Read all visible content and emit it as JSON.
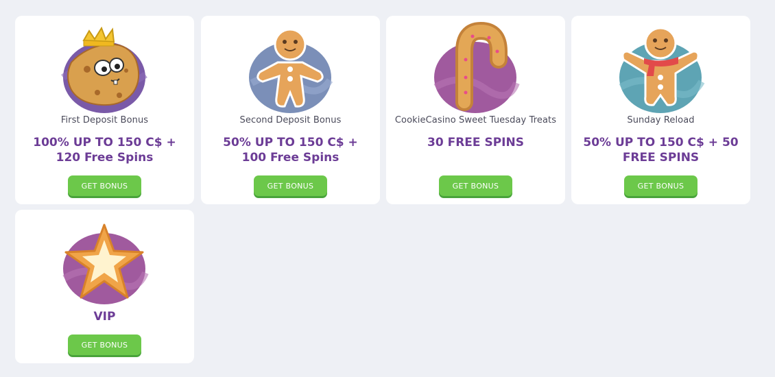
{
  "colors": {
    "page_bg": "#eef0f5",
    "card_bg": "#ffffff",
    "headline": "#6c3c96",
    "button": "#6cc84a",
    "button_shadow": "#48a33a",
    "subtitle": "#4a4a5a"
  },
  "cards": [
    {
      "icon": "crowned-cookie-icon",
      "subtitle": "First Deposit Bonus",
      "headline": "100% UP TO 150 C$ + 120 Free Spins",
      "button": "GET BONUS"
    },
    {
      "icon": "gingerbread-man-icon",
      "subtitle": "Second Deposit Bonus",
      "headline": "50% UP TO 150 C$ + 100 Free Spins",
      "button": "GET BONUS"
    },
    {
      "icon": "candy-cane-cookie-icon",
      "subtitle": "CookieCasino Sweet Tuesday Treats",
      "headline": "30 FREE SPINS",
      "button": "GET BONUS"
    },
    {
      "icon": "gingerbread-scarf-icon",
      "subtitle": "Sunday Reload",
      "headline": "50% UP TO 150 C$ + 50 FREE SPINS",
      "button": "GET BONUS"
    },
    {
      "icon": "star-cookie-icon",
      "headline": "VIP",
      "button": "GET BONUS"
    }
  ]
}
